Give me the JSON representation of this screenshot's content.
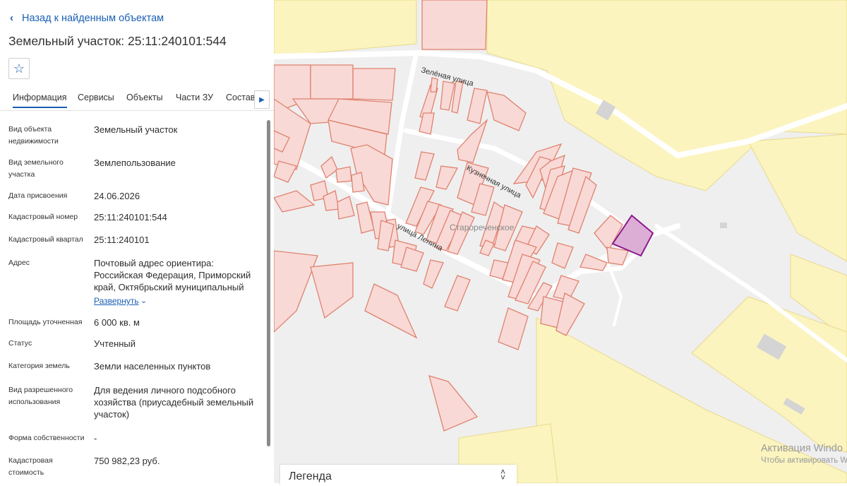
{
  "header": {
    "back_label": "Назад к найденным объектам",
    "title": "Земельный участок: 25:11:240101:544"
  },
  "tabs": [
    {
      "label": "Информация",
      "active": true
    },
    {
      "label": "Сервисы"
    },
    {
      "label": "Объекты"
    },
    {
      "label": "Части ЗУ"
    },
    {
      "label": "Состав"
    }
  ],
  "fields": [
    {
      "label": "Вид объекта недвижимости",
      "value": "Земельный участок"
    },
    {
      "label": "Вид земельного участка",
      "value": "Землепользование"
    },
    {
      "label": "Дата присвоения",
      "value": "24.06.2026"
    },
    {
      "label": "Кадастровый номер",
      "value": "25:11:240101:544"
    },
    {
      "label": "Кадастровый квартал",
      "value": "25:11:240101"
    },
    {
      "label": "Адрес",
      "value": "Почтовый адрес ориентира: Российская Федерация, Приморский край, Октябрьский муниципальный"
    },
    {
      "label": "Площадь уточненная",
      "value": "6 000 кв. м"
    },
    {
      "label": "Статус",
      "value": "Учтенный"
    },
    {
      "label": "Категория земель",
      "value": "Земли населенных пунктов"
    },
    {
      "label": "Вид разрешенного использования",
      "value": "Для ведения личного подсобного хозяйства (приусадебный земельный участок)"
    },
    {
      "label": "Форма собственности",
      "value": "-"
    },
    {
      "label": "Кадастровая стоимость",
      "value": "750 982,23 руб."
    }
  ],
  "address_expand_label": "Развернуть",
  "map": {
    "labels": {
      "street1": "Зелёная улица",
      "street2": "Кузнечная улица",
      "street3": "улица Ленина",
      "village": "Старореченское"
    },
    "colors": {
      "background": "#efefef",
      "yellow_zone": "#fbf4bf",
      "yellow_stroke": "#ead98a",
      "parcel_fill": "#f8d9d6",
      "parcel_stroke": "#e0826f",
      "selected_fill": "#dcaed6",
      "selected_stroke": "#8b1a8d"
    }
  },
  "legend": {
    "label": "Легенда"
  },
  "watermark": {
    "line1": "Активация Windo",
    "line2": "Чтобы активировать Win"
  }
}
